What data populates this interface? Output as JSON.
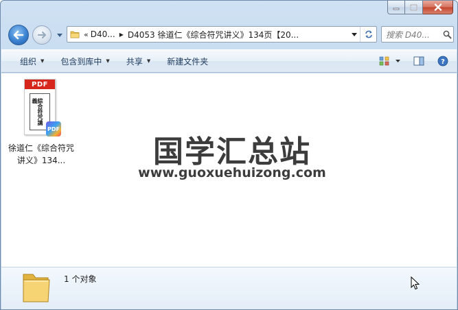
{
  "window": {
    "caption": {
      "minimize_icon": "minimize-icon",
      "maximize_icon": "maximize-icon",
      "close_icon": "close-icon"
    }
  },
  "navigation": {
    "breadcrumb_overflow": "«",
    "crumbs": [
      "D40...",
      "D4053 徐道仁《综合符咒讲义》134页【20..."
    ],
    "search_placeholder": "搜索 D40..."
  },
  "toolbar": {
    "items": [
      "组织",
      "包含到库中",
      "共享",
      "新建文件夹"
    ],
    "dropdown_items": [
      true,
      true,
      true,
      false
    ]
  },
  "content": {
    "files": [
      {
        "name": "徐道仁《综合符咒讲义》134...",
        "type_label": "PDF",
        "badge_label": "PDF",
        "cover_title": "綜合符咒講義"
      }
    ],
    "watermark": {
      "title": "国学汇总站",
      "url": "www.guoxuehuizong.com"
    }
  },
  "details": {
    "summary": "1 个对象"
  },
  "colors": {
    "pdf_red": "#d7261b",
    "folder_yellow": "#f0c850",
    "accent_blue": "#3b82d1"
  }
}
